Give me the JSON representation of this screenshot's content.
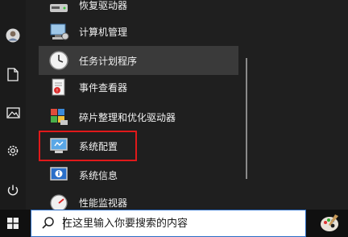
{
  "start_menu": {
    "items": [
      {
        "label": "恢复驱动器",
        "icon": "recovery-drive-icon"
      },
      {
        "label": "计算机管理",
        "icon": "computer-management-icon"
      },
      {
        "label": "任务计划程序",
        "icon": "task-scheduler-icon"
      },
      {
        "label": "事件查看器",
        "icon": "event-viewer-icon"
      },
      {
        "label": "碎片整理和优化驱动器",
        "icon": "defragment-icon"
      },
      {
        "label": "系统配置",
        "icon": "system-config-icon"
      },
      {
        "label": "系统信息",
        "icon": "system-info-icon"
      },
      {
        "label": "性能监视器",
        "icon": "performance-monitor-icon"
      }
    ],
    "hovered_item": "任务计划程序",
    "highlighted_item": "系统配置"
  },
  "left_rail": [
    "user-avatar-icon",
    "documents-icon",
    "pictures-icon",
    "settings-gear-icon",
    "power-icon"
  ],
  "taskbar": {
    "start_icon": "windows-logo-icon",
    "search": {
      "placeholder": "在这里输入你要搜索的内容",
      "value": ""
    },
    "pinned_app_icon": "paint-app-icon"
  },
  "colors": {
    "highlight_border": "#e0191a",
    "search_border": "#2c6cc4"
  }
}
